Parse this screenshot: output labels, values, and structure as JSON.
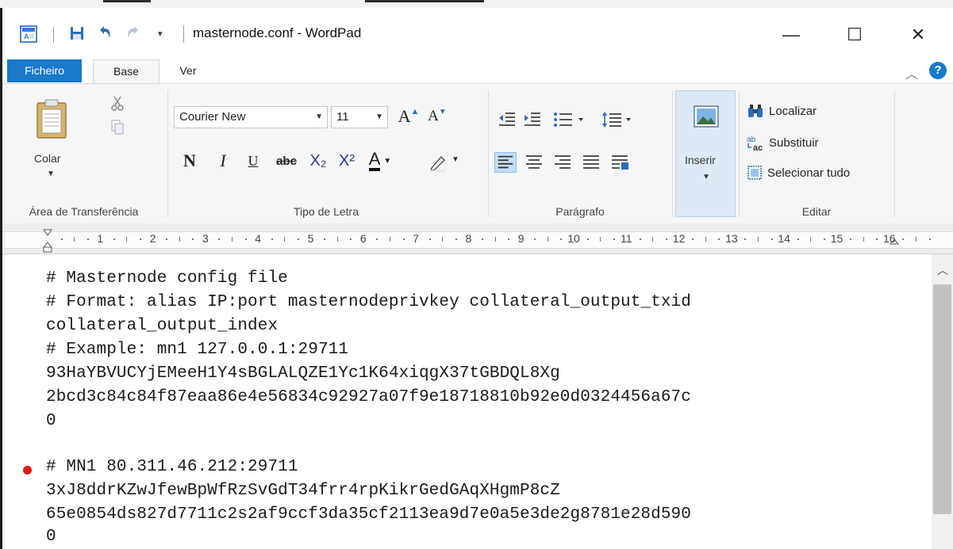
{
  "window": {
    "title": "masternode.conf - WordPad",
    "controls": {
      "minimize": "—",
      "maximize": "☐",
      "close": "✕"
    }
  },
  "quick_access": [
    "save-icon",
    "undo-icon",
    "redo-icon",
    "customize-chevron"
  ],
  "tabs": [
    {
      "label": "Ficheiro",
      "active": false
    },
    {
      "label": "Base",
      "active": true
    },
    {
      "label": "Ver",
      "active": false
    }
  ],
  "ribbon": {
    "clipboard": {
      "label": "Área de Transferência",
      "paste": "Colar"
    },
    "font": {
      "label": "Tipo de Letra",
      "family": "Courier New",
      "size": "11",
      "buttons": [
        "N",
        "I",
        "U",
        "abc",
        "X₂",
        "X²",
        "A"
      ]
    },
    "paragraph": {
      "label": "Parágrafo"
    },
    "insert": {
      "label": "Inserir"
    },
    "edit": {
      "label": "Editar",
      "find": "Localizar",
      "replace": "Substituir",
      "select_all": "Selecionar tudo"
    }
  },
  "ruler": {
    "marks": [
      "1",
      "2",
      "3",
      "4",
      "5",
      "6",
      "7",
      "8",
      "9",
      "10",
      "11",
      "12",
      "13",
      "14",
      "15",
      "16"
    ]
  },
  "document": {
    "lines": [
      "# Masternode config file",
      "# Format: alias IP:port masternodeprivkey collateral_output_txid",
      "collateral_output_index",
      "# Example: mn1 127.0.0.1:29711",
      "93HaYBVUCYjEMeeH1Y4sBGLALQZE1Yc1K64xiqgX37tGBDQL8Xg",
      "2bcd3c84c84f87eaa86e4e56834c92927a07f9e18718810b92e0d0324456a67c",
      "0",
      "",
      "# MN1 80.311.46.212:29711",
      "3xJ8ddrKZwJfewBpWfRzSvGdT34frr4rpKikrGedGAqXHgmP8cZ",
      "65e0854ds827d7711c2s2af9ccf3da35cf2113ea9d7e0a5e3de2g8781e28d590",
      "0"
    ]
  },
  "colors": {
    "accent": "#1979ca",
    "ribbon_bg": "#f5f6f7",
    "marker": "#e31b1b"
  }
}
